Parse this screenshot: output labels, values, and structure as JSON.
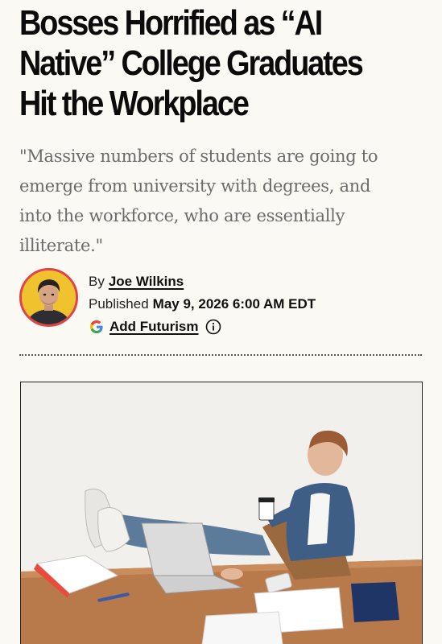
{
  "article": {
    "headline_lines": [
      "Bosses Horrified as “AI",
      "Native” College Graduates",
      "Hit the Workplace"
    ],
    "dek_lines": [
      "\"Massive numbers of students are going to",
      "emerge from university with degrees, and",
      "into the workforce, who are essentially",
      "illiterate.\""
    ]
  },
  "byline": {
    "by_label": "By",
    "author": "Joe Wilkins",
    "published_label": "Published",
    "date": "May 9, 2026 6:00 AM EDT",
    "add_source_label": "Add Futurism"
  },
  "icons": {
    "google": "google-g-icon",
    "info": "info-icon"
  },
  "colors": {
    "background": "#fbf9f3",
    "avatar_ring": "#e0414a",
    "avatar_fill": "#f0c22e",
    "text": "#111111",
    "dek_text": "#6b6b6b"
  }
}
